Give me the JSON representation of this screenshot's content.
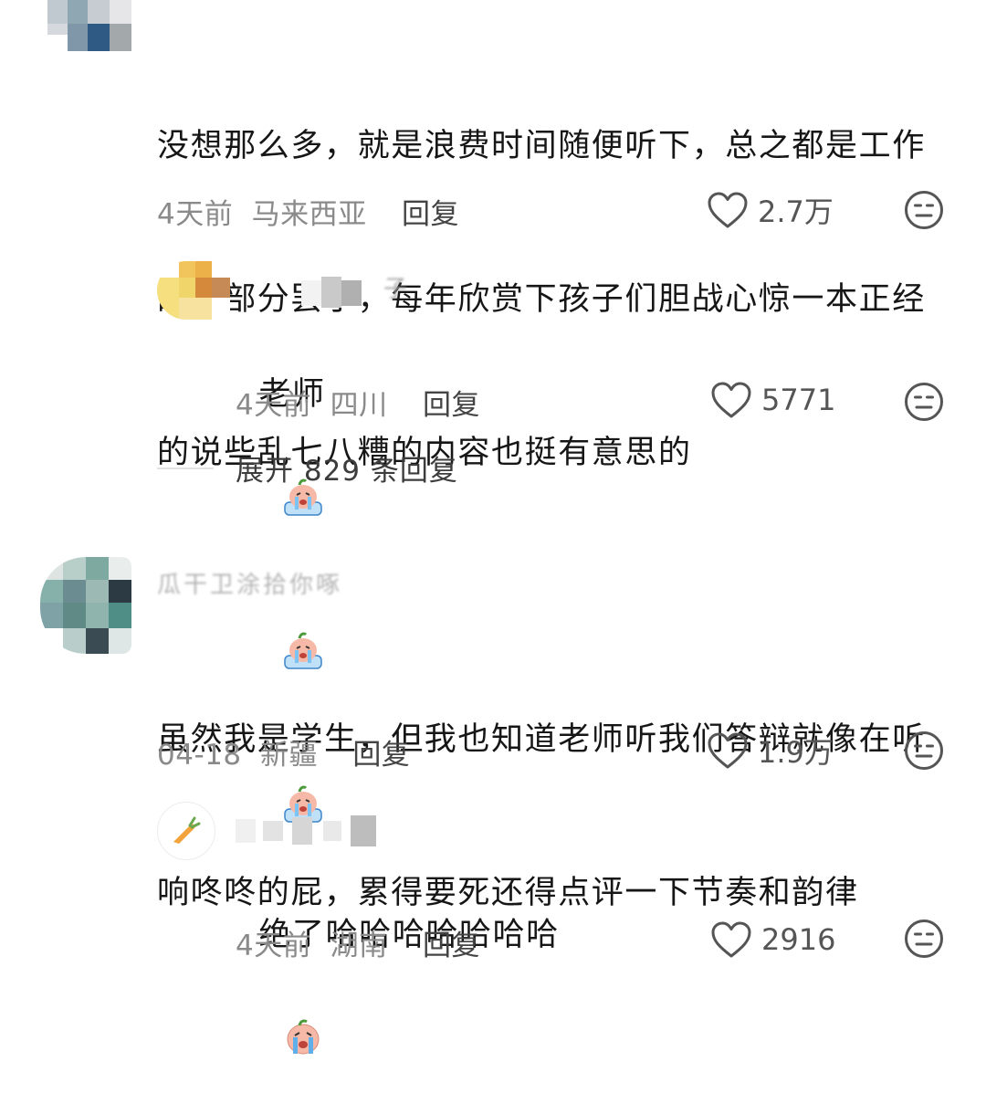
{
  "comments": [
    {
      "text_lines": [
        "没想那么多，就是浪费时间随便听下，总之都是工作",
        "的一部分罢了，每年欣赏下孩子们胆战心惊一本正经",
        "的说些乱七八糟的内容也挺有意思的"
      ],
      "time": "4天前",
      "location": "马来西亚",
      "reply_label": "回复",
      "likes": "2.7万",
      "replies": [
        {
          "username": "子",
          "text": "老师",
          "time": "4天前",
          "location": "四川",
          "reply_label": "回复",
          "likes": "5771"
        }
      ],
      "expand_label": "展开 829 条回复"
    },
    {
      "username": "瓜干卫涂拾你啄",
      "text_lines": [
        "虽然我是学生，但我也知道老师听我们答辩就像在听",
        "响咚咚的屁，累得要死还得点评一下节奏和韵律"
      ],
      "time": "04-18",
      "location": "新疆",
      "reply_label": "回复",
      "likes": "1.9万",
      "replies": [
        {
          "username": "",
          "text": "绝了哈哈哈哈哈哈哈",
          "time": "4天前",
          "location": "湖南",
          "reply_label": "回复",
          "likes": "2916"
        }
      ]
    }
  ],
  "icons": {
    "like": "heart-outline-icon",
    "dislike": "meh-face-icon",
    "sticker": "crying-peach-sticker"
  },
  "colors": {
    "text": "#161616",
    "meta": "#8a8a8a",
    "icon": "#555555"
  }
}
